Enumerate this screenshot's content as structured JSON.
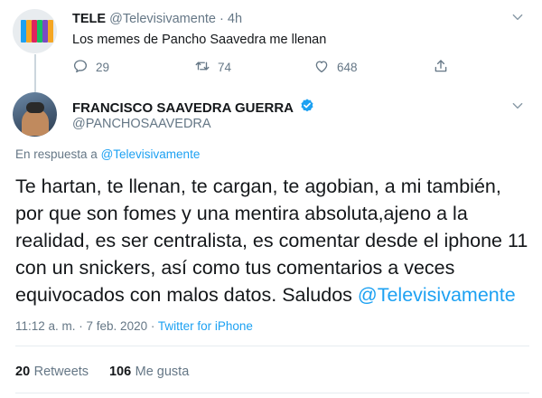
{
  "parent_tweet": {
    "display_name": "TELE",
    "handle": "@Televisivamente",
    "separator": "·",
    "time": "4h",
    "text": "Los memes de Pancho Saavedra me llenan",
    "replies": "29",
    "retweets": "74",
    "likes": "648",
    "avatar_colors": [
      "#1da1f2",
      "#f5a623",
      "#e0245e",
      "#17bf63",
      "#794bc4",
      "#f5a623"
    ]
  },
  "main_tweet": {
    "display_name": "FRANCISCO SAAVEDRA GUERRA",
    "handle": "@PANCHOSAAVEDRA",
    "reply_prefix": "En respuesta a",
    "reply_to": "@Televisivamente",
    "text": "Te hartan, te llenan, te cargan, te agobian, a mi también, por que son fomes y una mentira absoluta,ajeno a la realidad, es ser centralista, es comentar desde el iphone 11 con un snickers, así como tus comentarios a veces equivocados con malos datos. Saludos",
    "text_mention": "@Televisivamente",
    "timestamp": "11:12 a. m. · 7 feb. 2020",
    "meta_separator": "·",
    "source": "Twitter for iPhone",
    "retweets_count": "20",
    "retweets_label": "Retweets",
    "likes_count": "106",
    "likes_label": "Me gusta"
  },
  "icons": {
    "more": "chevron-down-icon",
    "reply": "reply-icon",
    "retweet": "retweet-icon",
    "like": "heart-icon",
    "share": "share-icon",
    "verified": "verified-badge-icon"
  },
  "colors": {
    "link": "#1da1f2",
    "text": "#14171a",
    "muted": "#657786",
    "divider": "#e6ecf0"
  }
}
